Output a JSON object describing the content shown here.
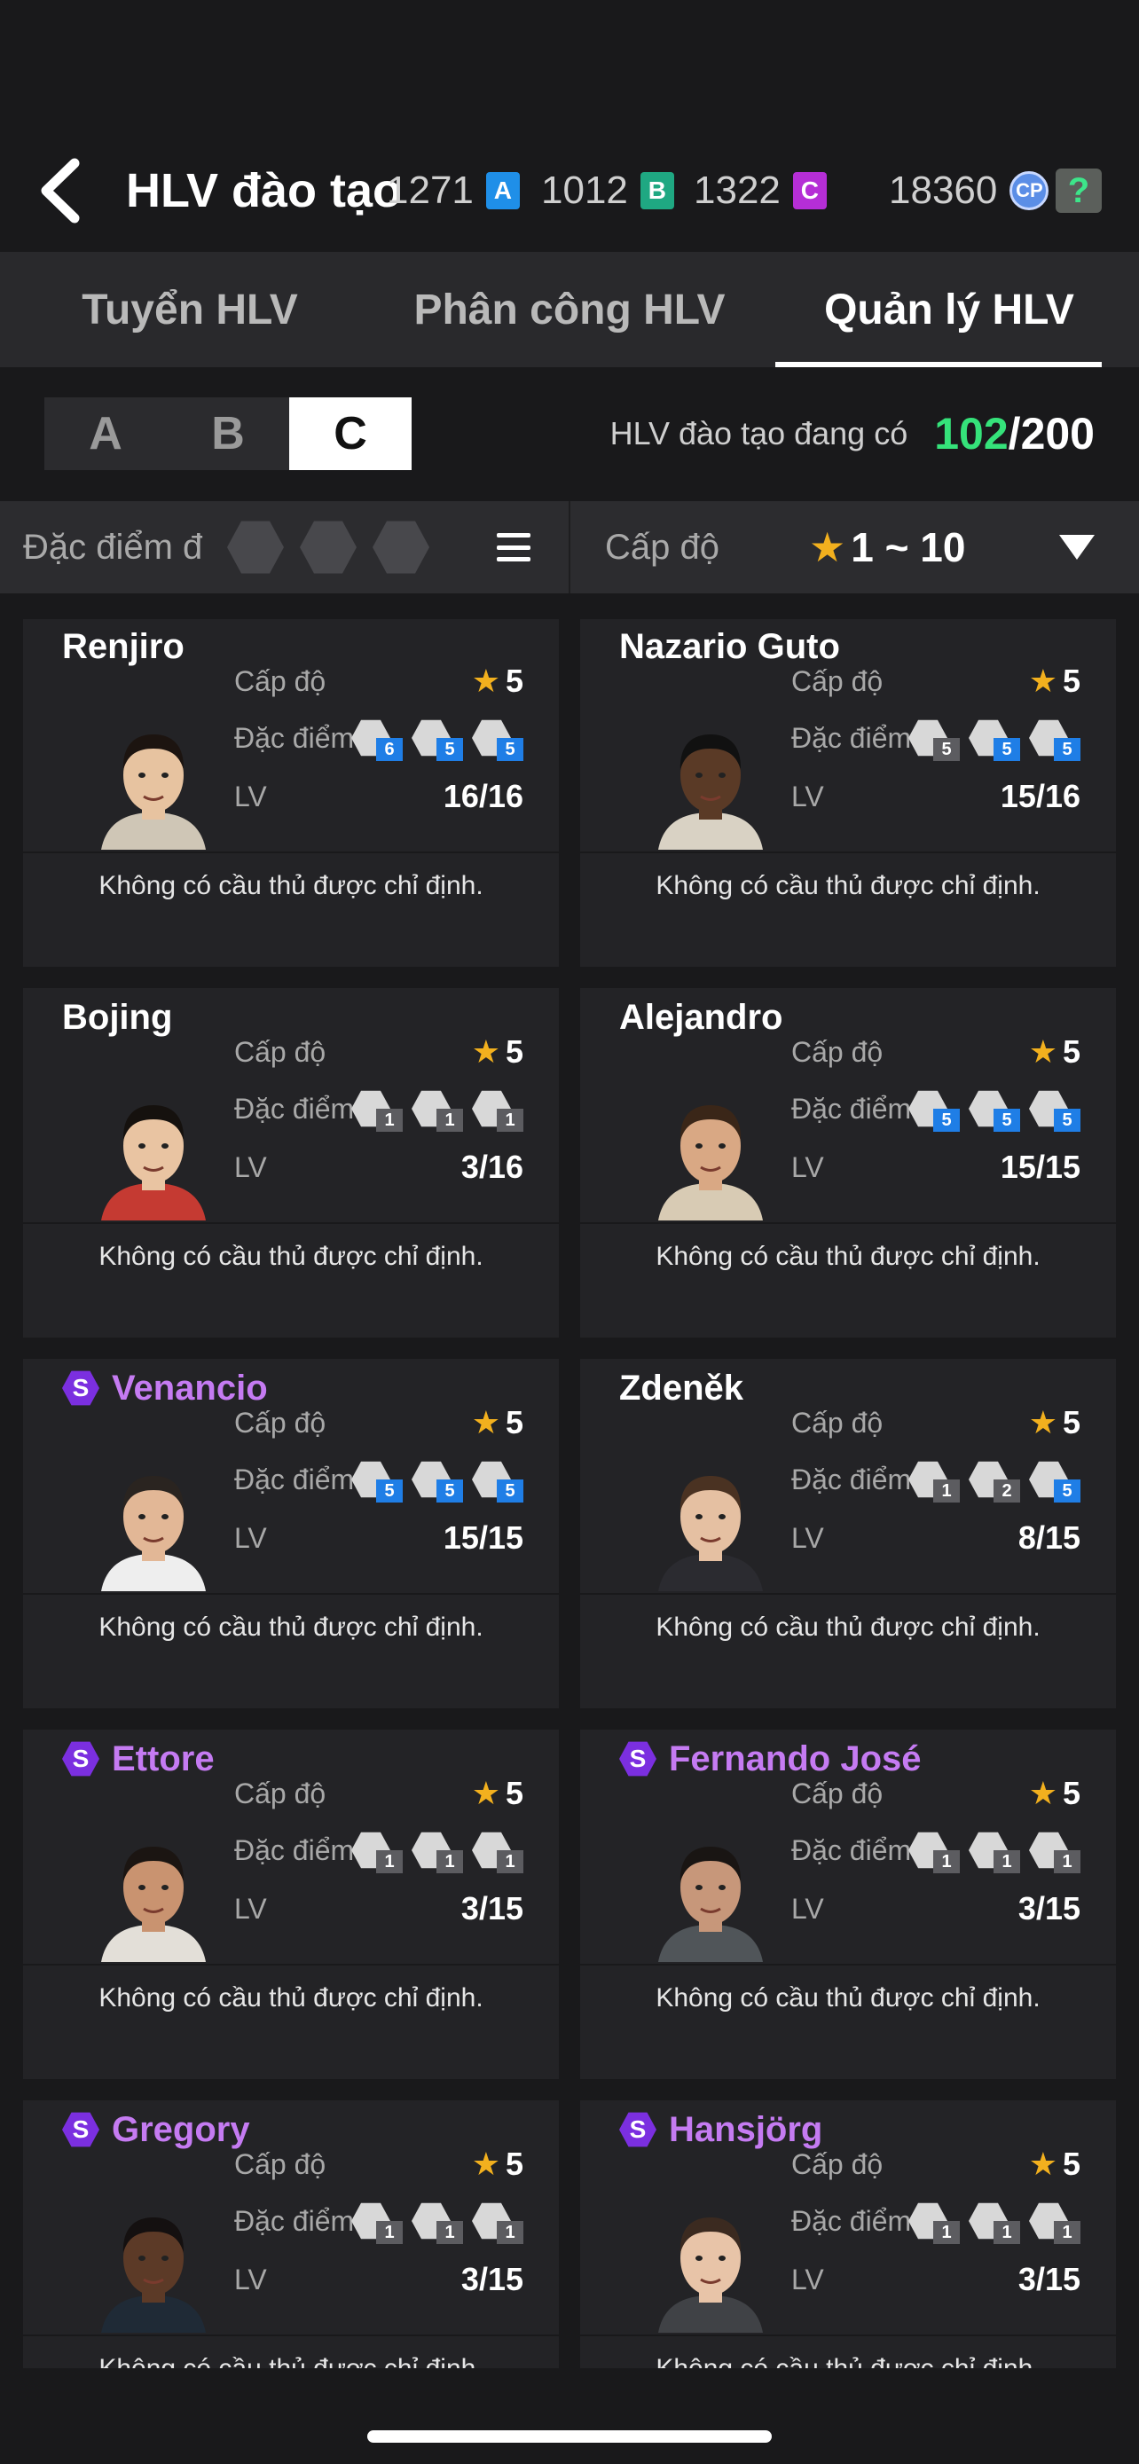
{
  "header": {
    "title": "HLV đào tạo",
    "currencies": [
      {
        "value": "1271",
        "badge": "A",
        "color": "#1f8fe8"
      },
      {
        "value": "1012",
        "badge": "B",
        "color": "#1fa882"
      },
      {
        "value": "1322",
        "badge": "C",
        "color": "#b52ed6"
      }
    ],
    "cp_value": "18360",
    "cp_badge": "CP",
    "help_label": "?"
  },
  "tabs": [
    {
      "label": "Tuyển HLV",
      "active": false
    },
    {
      "label": "Phân công  HLV",
      "active": false
    },
    {
      "label": "Quản lý HLV",
      "active": true
    }
  ],
  "segments": [
    {
      "label": "A",
      "active": false
    },
    {
      "label": "B",
      "active": false
    },
    {
      "label": "C",
      "active": true
    }
  ],
  "coach_count": {
    "label": "HLV đào tạo đang có",
    "current": "102",
    "max": "/200"
  },
  "filter": {
    "trait_label": "Đặc điểm đ",
    "level_label": "Cấp độ",
    "level_range": "1 ~ 10"
  },
  "labels": {
    "level": "Cấp độ",
    "trait": "Đặc điểm",
    "lv": "LV",
    "no_player": "Không có cầu thủ được chỉ định."
  },
  "coaches": [
    {
      "name": "Renjiro",
      "special": false,
      "level": "5",
      "lv": "16/16",
      "traits": [
        {
          "n": "6",
          "c": "blue"
        },
        {
          "n": "5",
          "c": "blue"
        },
        {
          "n": "5",
          "c": "blue"
        }
      ],
      "skin": "#e7c3a0",
      "hair": "#1c1410",
      "shirt": "#cfc6b6"
    },
    {
      "name": "Nazario Guto",
      "special": false,
      "level": "5",
      "lv": "15/16",
      "traits": [
        {
          "n": "5",
          "c": "gray"
        },
        {
          "n": "5",
          "c": "blue"
        },
        {
          "n": "5",
          "c": "blue"
        }
      ],
      "skin": "#5a3a26",
      "hair": "#111111",
      "shirt": "#d9d2c4"
    },
    {
      "name": "Bojing",
      "special": false,
      "level": "5",
      "lv": "3/16",
      "traits": [
        {
          "n": "1",
          "c": "gray"
        },
        {
          "n": "1",
          "c": "gray"
        },
        {
          "n": "1",
          "c": "gray"
        }
      ],
      "skin": "#e9c4a2",
      "hair": "#15110e",
      "shirt": "#c53a32"
    },
    {
      "name": "Alejandro",
      "special": false,
      "level": "5",
      "lv": "15/15",
      "traits": [
        {
          "n": "5",
          "c": "blue"
        },
        {
          "n": "5",
          "c": "blue"
        },
        {
          "n": "5",
          "c": "blue"
        }
      ],
      "skin": "#d9a884",
      "hair": "#3a2618",
      "shirt": "#d8cbb4"
    },
    {
      "name": "Venancio",
      "special": true,
      "level": "5",
      "lv": "15/15",
      "traits": [
        {
          "n": "5",
          "c": "blue"
        },
        {
          "n": "5",
          "c": "blue"
        },
        {
          "n": "5",
          "c": "blue"
        }
      ],
      "skin": "#e2b796",
      "hair": "#2a2420",
      "shirt": "#eeeeee"
    },
    {
      "name": "Zdeněk",
      "special": false,
      "level": "5",
      "lv": "8/15",
      "traits": [
        {
          "n": "1",
          "c": "gray"
        },
        {
          "n": "2",
          "c": "gray"
        },
        {
          "n": "5",
          "c": "blue"
        }
      ],
      "skin": "#e5c0a2",
      "hair": "#4a3222",
      "shirt": "#2b2b30"
    },
    {
      "name": "Ettore",
      "special": true,
      "level": "5",
      "lv": "3/15",
      "traits": [
        {
          "n": "1",
          "c": "gray"
        },
        {
          "n": "1",
          "c": "gray"
        },
        {
          "n": "1",
          "c": "gray"
        }
      ],
      "skin": "#c99370",
      "hair": "#1b1512",
      "shirt": "#e3dfd8"
    },
    {
      "name": "Fernando José",
      "special": true,
      "level": "5",
      "lv": "3/15",
      "traits": [
        {
          "n": "1",
          "c": "gray"
        },
        {
          "n": "1",
          "c": "gray"
        },
        {
          "n": "1",
          "c": "gray"
        }
      ],
      "skin": "#c7977a",
      "hair": "#191513",
      "shirt": "#505559"
    },
    {
      "name": "Gregory",
      "special": true,
      "level": "5",
      "lv": "3/15",
      "traits": [
        {
          "n": "1",
          "c": "gray"
        },
        {
          "n": "1",
          "c": "gray"
        },
        {
          "n": "1",
          "c": "gray"
        }
      ],
      "skin": "#5c3a27",
      "hair": "#141010",
      "shirt": "#1f2a36"
    },
    {
      "name": "Hansjörg",
      "special": true,
      "level": "5",
      "lv": "3/15",
      "traits": [
        {
          "n": "1",
          "c": "gray"
        },
        {
          "n": "1",
          "c": "gray"
        },
        {
          "n": "1",
          "c": "gray"
        }
      ],
      "skin": "#e8c4a8",
      "hair": "#3b2a20",
      "shirt": "#404246"
    }
  ]
}
